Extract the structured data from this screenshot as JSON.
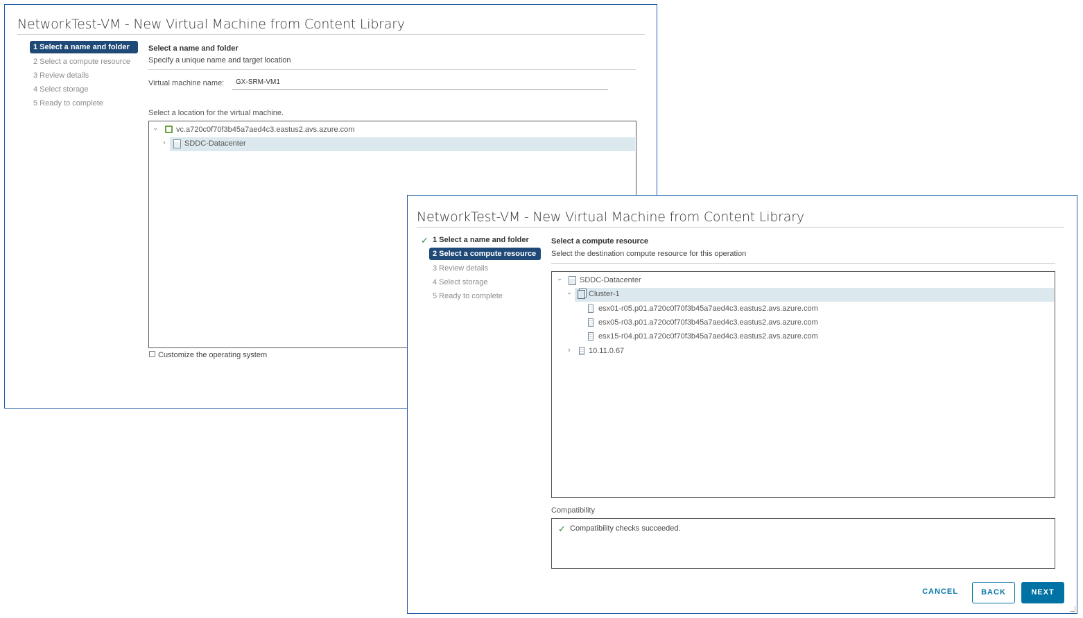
{
  "dialog1": {
    "title": "NetworkTest-VM - New Virtual Machine from Content Library",
    "steps": [
      "1 Select a name and folder",
      "2 Select a compute resource",
      "3 Review details",
      "4 Select storage",
      "5 Ready to complete"
    ],
    "section_title": "Select a name and folder",
    "section_subtitle": "Specify a unique name and target location",
    "vm_name_label": "Virtual machine name:",
    "vm_name_value": "GX-SRM-VM1",
    "location_label": "Select a location for the virtual machine.",
    "tree": [
      {
        "label": "vc.a720c0f70f3b45a7aed4c3.eastus2.avs.azure.com",
        "icon": "vcenter-icon",
        "expanded": true
      },
      {
        "label": "SDDC-Datacenter",
        "icon": "datacenter-icon",
        "expanded": false,
        "selected": true
      }
    ],
    "customize_label": "Customize the operating system"
  },
  "dialog2": {
    "title": "NetworkTest-VM - New Virtual Machine from Content Library",
    "steps": [
      "1 Select a name and folder",
      "2 Select a compute resource",
      "3 Review details",
      "4 Select storage",
      "5 Ready to complete"
    ],
    "section_title": "Select a compute resource",
    "section_subtitle": "Select the destination compute resource for this operation",
    "tree": [
      {
        "label": "SDDC-Datacenter",
        "icon": "datacenter-icon",
        "expanded": true
      },
      {
        "label": "Cluster-1",
        "icon": "cluster-icon",
        "expanded": true,
        "selected": true
      },
      {
        "label": "esx01-r05.p01.a720c0f70f3b45a7aed4c3.eastus2.avs.azure.com",
        "icon": "host-icon"
      },
      {
        "label": "esx05-r03.p01.a720c0f70f3b45a7aed4c3.eastus2.avs.azure.com",
        "icon": "host-icon"
      },
      {
        "label": "esx15-r04.p01.a720c0f70f3b45a7aed4c3.eastus2.avs.azure.com",
        "icon": "host-icon"
      },
      {
        "label": "10.11.0.67",
        "icon": "host-icon",
        "expanded": false
      }
    ],
    "compat_label": "Compatibility",
    "compat_message": "Compatibility checks succeeded.",
    "buttons": {
      "cancel": "CANCEL",
      "back": "BACK",
      "next": "NEXT"
    }
  },
  "colors": {
    "accent": "#0072a3",
    "active_step": "#1f4a78",
    "success": "#2e8b3c",
    "selection": "#dbe8ee",
    "frame_border": "#1f5aa6"
  }
}
